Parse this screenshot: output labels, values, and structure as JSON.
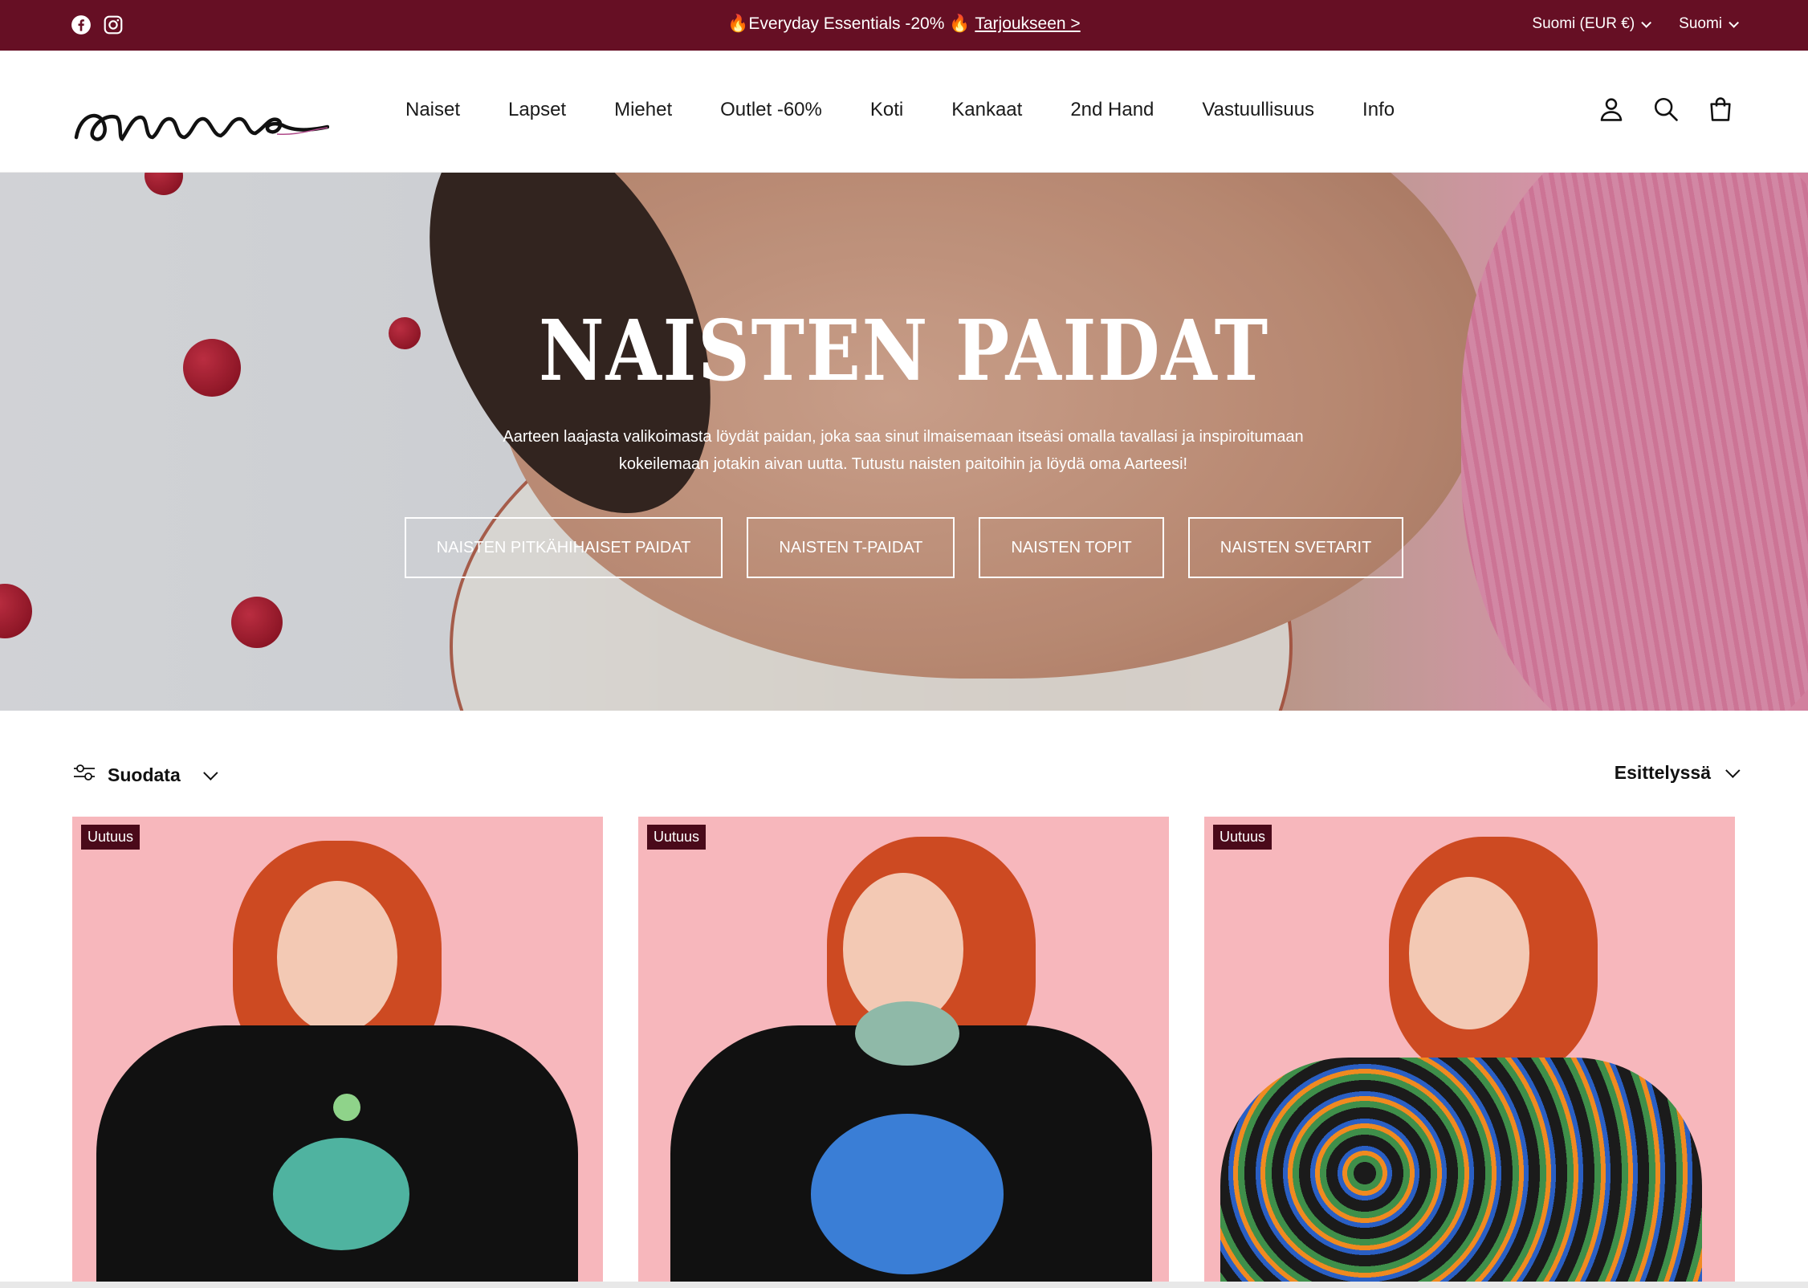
{
  "announcement": {
    "promo_text": "🔥Everyday Essentials -20% 🔥",
    "promo_link": "Tarjoukseen >",
    "currency": "Suomi (EUR €)",
    "language": "Suomi",
    "icons": [
      "facebook-icon",
      "instagram-icon"
    ]
  },
  "header": {
    "logo_alt": "aarre",
    "nav": [
      "Naiset",
      "Lapset",
      "Miehet",
      "Outlet -60%",
      "Koti",
      "Kankaat",
      "2nd Hand",
      "Vastuullisuus",
      "Info"
    ],
    "icons": [
      "account-icon",
      "search-icon",
      "cart-icon"
    ]
  },
  "hero": {
    "title": "NAISTEN PAIDAT",
    "description": "Aarteen laajasta valikoimasta löydät paidan, joka saa sinut ilmaisemaan itseäsi omalla tavallasi ja inspiroitumaan kokeilemaan jotakin aivan uutta. Tutustu naisten paitoihin ja löydä oma Aarteesi!",
    "buttons": [
      "NAISTEN PITKÄHIHAISET PAIDAT",
      "NAISTEN T-PAIDAT",
      "NAISTEN TOPIT",
      "NAISTEN SVETARIT"
    ]
  },
  "toolbar": {
    "filter_label": "Suodata",
    "sort_label": "Esittelyssä"
  },
  "products": [
    {
      "badge": "Uutuus"
    },
    {
      "badge": "Uutuus"
    },
    {
      "badge": "Uutuus"
    }
  ],
  "colors": {
    "announcement_bg": "#660f24",
    "badge_bg": "#4a0a1a",
    "product_bg": "#f7b7bc"
  }
}
